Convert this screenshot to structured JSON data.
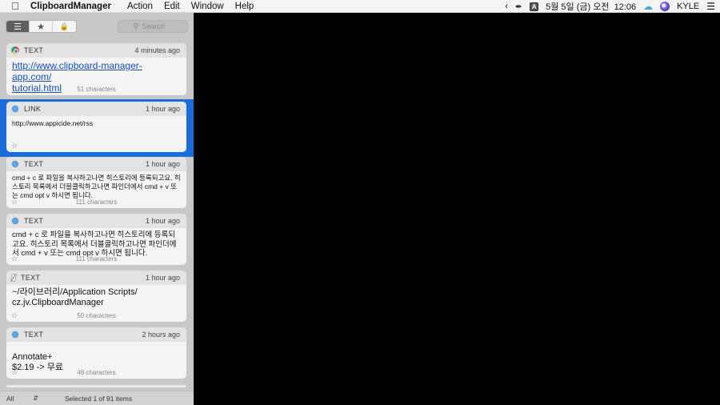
{
  "menubar": {
    "apple_icon": "apple-logo",
    "app_name": "ClipboardManager",
    "menus": [
      "Action",
      "Edit",
      "Window",
      "Help"
    ],
    "status": {
      "date_time": "5월 5일 (금) 오전  12:06",
      "user": "KYLE",
      "input_badge": "A",
      "weather_badge": "2"
    }
  },
  "toolbar": {
    "segments": [
      {
        "name": "list",
        "icon": "list-icon",
        "active": true
      },
      {
        "name": "favorites",
        "icon": "star-icon",
        "active": false
      },
      {
        "name": "locked",
        "icon": "lock-icon",
        "active": false
      }
    ],
    "search": {
      "placeholder": "Search",
      "value": ""
    }
  },
  "clips": [
    {
      "app": "chrome",
      "type": "TEXT",
      "time": "4 minutes ago",
      "content": " http://www.clipboard-manager-app.com/\ntutorial.html",
      "chars": "51 characters",
      "selected": false
    },
    {
      "app": "safari",
      "type": "LINK",
      "time": "1 hour ago",
      "content": "http://www.appicide.net/rss",
      "chars": "",
      "selected": true
    },
    {
      "app": "safari",
      "type": "TEXT",
      "time": "1 hour ago",
      "content": "cmd + c 로 파일을 복사하고나면 히스토리에 등록되고요. 히스토리 목록에서 더블클릭하고나면 파인더에서 cmd + v  또는 cmd opt v 하시면 됩니다.",
      "chars": "111 characters",
      "selected": false
    },
    {
      "app": "safari",
      "type": "TEXT",
      "time": "1 hour ago",
      "content": "cmd + c 로 파일을 복사하고나면 히스토리에 등록되고요. 히스토리 목록에서 더블클릭하고나면 파인더에서 cmd + v  또는 cmd opt v 하시면 됩니다.",
      "chars": "111 characters",
      "selected": false
    },
    {
      "app": "script-editor",
      "type": "TEXT",
      "time": "1 hour ago",
      "content": "~/라이브러리/Application Scripts/\ncz.jv.ClipboardManager",
      "chars": "50 characters",
      "selected": false
    },
    {
      "app": "safari",
      "type": "TEXT",
      "time": "2 hours ago",
      "content": "\nAnnotate+\n$2.19 -> 무료",
      "chars": "48 characters",
      "selected": false
    }
  ],
  "statusbar": {
    "filter": "All",
    "count_text": "Selected 1 of 91 items"
  },
  "colors": {
    "selection": "#1b6cd8",
    "link": "#1a4fb5"
  }
}
